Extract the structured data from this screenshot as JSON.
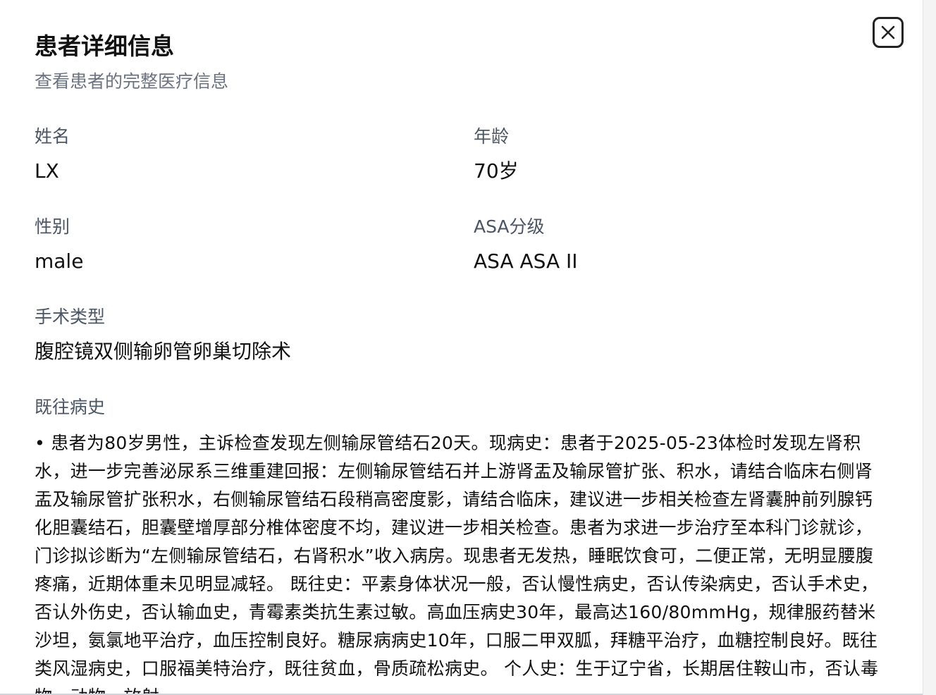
{
  "dialog": {
    "title": "患者详细信息",
    "subtitle": "查看患者的完整医疗信息"
  },
  "fields": {
    "name": {
      "label": "姓名",
      "value": "LX"
    },
    "age": {
      "label": "年龄",
      "value": "70岁"
    },
    "gender": {
      "label": "性别",
      "value": "male"
    },
    "asa": {
      "label": "ASA分级",
      "value": "ASA ASA II"
    },
    "surgery": {
      "label": "手术类型",
      "value": "腹腔镜双侧输卵管卵巢切除术"
    },
    "history": {
      "label": "既往病史",
      "value": "• 患者为80岁男性，主诉检查发现左侧输尿管结石20天。现病史：患者于2025-05-23体检时发现左肾积水，进一步完善泌尿系三维重建回报：左侧输尿管结石并上游肾盂及输尿管扩张、积水，请结合临床右侧肾盂及输尿管扩张积水，右侧输尿管结石段稍高密度影，请结合临床，建议进一步相关检查左肾囊肿前列腺钙化胆囊结石，胆囊壁增厚部分椎体密度不均，建议进一步相关检查。患者为求进一步治疗至本科门诊就诊，门诊拟诊断为“左侧输尿管结石，右肾积水”收入病房。现患者无发热，睡眠饮食可，二便正常，无明显腰腹疼痛，近期体重未见明显减轻。 既往史：平素身体状况一般，否认慢性病史，否认传染病史，否认手术史，否认外伤史，否认输血史，青霉素类抗生素过敏。高血压病史30年，最高达160/80mmHg，规律服药替米沙坦，氨氯地平治疗，血压控制良好。糖尿病病史10年，口服二甲双胍，拜糖平治疗，血糖控制良好。既往类风湿病史，口服福美特治疗，既往贫血，骨质疏松病史。 个人史：生于辽宁省，长期居住鞍山市，否认毒物、动物、放射"
    }
  },
  "close_icon": "close-icon"
}
